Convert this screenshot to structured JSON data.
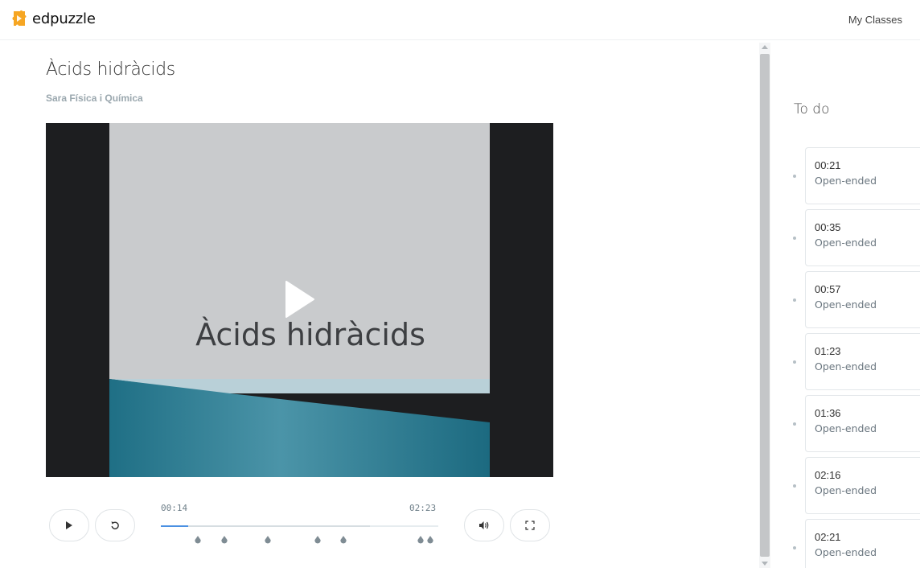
{
  "header": {
    "brand": "edpuzzle",
    "nav_link": "My Classes"
  },
  "video": {
    "title": "Àcids hidràcids",
    "author": "Sara Física i Química",
    "slide_text": "Àcids hidràcids",
    "current_time": "00:14",
    "duration": "02:23",
    "progress_fraction": 0.098,
    "marker_times": [
      "00:21",
      "00:35",
      "00:57",
      "01:23",
      "01:36",
      "02:16",
      "02:21"
    ]
  },
  "sidebar": {
    "heading": "To do",
    "questions": [
      {
        "time": "00:21",
        "type": "Open-ended"
      },
      {
        "time": "00:35",
        "type": "Open-ended"
      },
      {
        "time": "00:57",
        "type": "Open-ended"
      },
      {
        "time": "01:23",
        "type": "Open-ended"
      },
      {
        "time": "01:36",
        "type": "Open-ended"
      },
      {
        "time": "02:16",
        "type": "Open-ended"
      },
      {
        "time": "02:21",
        "type": "Open-ended"
      }
    ]
  },
  "icons": {
    "logo": "edpuzzle-logo-icon",
    "play": "play-icon",
    "rewind": "rewind-icon",
    "volume": "volume-icon",
    "fullscreen": "fullscreen-icon"
  },
  "colors": {
    "brand_orange": "#f6a623",
    "progress": "#4a90e2",
    "slide_teal": "#2a7d92"
  }
}
